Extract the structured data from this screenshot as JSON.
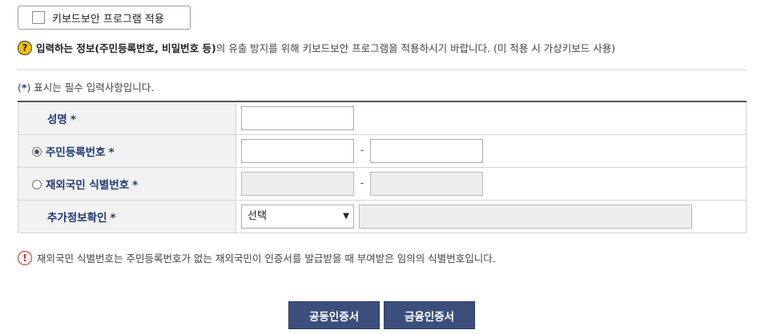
{
  "keyboard_security": {
    "label": "키보드보안 프로그램 적용",
    "checked": false
  },
  "notice": {
    "icon": "question-icon",
    "bold_text": "입력하는 정보(주민등록번호, 비밀번호 등)",
    "text": "의 유출 방지를 위해 키보드보안 프로그램을 적용하시기 바랍니다. (미 적용 시 가상키보드 사용)"
  },
  "required_note": {
    "prefix": "(",
    "star": "*",
    "suffix": ") 표시는 필수 입력사항입니다."
  },
  "form": {
    "name_label": "성명",
    "resident_label": "주민등록번호",
    "foreigner_label": "재외국민 식별번호",
    "extra_label": "추가정보확인",
    "required_mark": "*",
    "dash": "-",
    "select_value": "선택",
    "selected_radio": "resident"
  },
  "warning": {
    "icon": "exclamation-icon",
    "text": "재외국민 식별번호는 주민등록번호가 없는 재외국민이 인증서를 발급받을 때 부여받은 임의의 식별번호입니다."
  },
  "buttons": {
    "joint_cert": "공동인증서",
    "financial_cert": "금융인증서"
  },
  "colors": {
    "label_text": "#1f3a73",
    "button_bg": "#3c4f7c",
    "notice_icon": "#f5c400",
    "warning_icon": "#c0392b"
  }
}
